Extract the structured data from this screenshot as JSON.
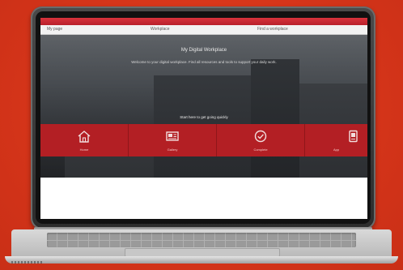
{
  "colors": {
    "background": "#d8361a",
    "accent_red": "#b31f24",
    "screen_white": "#ffffff"
  },
  "navbar": {
    "items": [
      "My page",
      "Workplace",
      "Find a workplace"
    ]
  },
  "hero": {
    "title": "My Digital Workplace",
    "description": "Welcome to your digital workplace. Find all resources and tools to support your daily work."
  },
  "quick_links": {
    "title": "Start here to get going quickly",
    "tiles": [
      {
        "icon": "home-icon",
        "label": "Home"
      },
      {
        "icon": "gallery-icon",
        "label": "Gallery"
      },
      {
        "icon": "check-circle-icon",
        "label": "Complete"
      },
      {
        "icon": "device-icon",
        "label": "App"
      }
    ]
  }
}
